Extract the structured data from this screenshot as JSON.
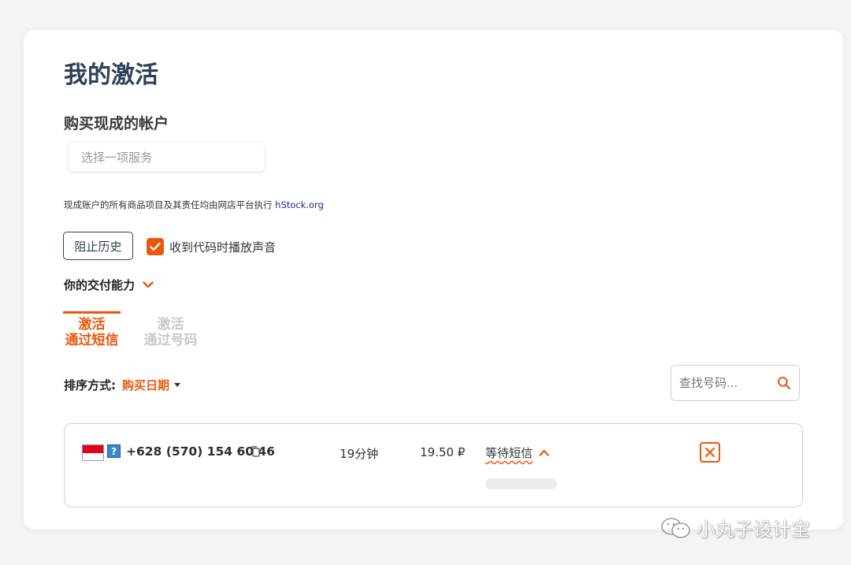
{
  "page_title": "我的激活",
  "section_title": "购买现成的帐户",
  "service_select": {
    "placeholder": "选择一项服务"
  },
  "notice": {
    "text": "现成账户的所有商品项目及其责任均由网店平台执行 ",
    "link": "hStock.org"
  },
  "controls": {
    "block_history_label": "阻止历史",
    "sound_on_code_label": "收到代码时播放声音",
    "sound_on_code_checked": true
  },
  "delivery": {
    "label": "你的交付能力"
  },
  "tabs": [
    {
      "line1": "激活",
      "line2": "通过短信",
      "active": true
    },
    {
      "line1": "激活",
      "line2": "通过号码",
      "active": false
    }
  ],
  "sort": {
    "label": "排序方式:",
    "value": "购买日期"
  },
  "search": {
    "placeholder": "查找号码..."
  },
  "activation": {
    "phone": "+628 (570) 154 60 46",
    "time": "19分钟",
    "price": "19.50 ₽",
    "status": "等待短信"
  },
  "watermark": {
    "text": "小丸子设计宝"
  },
  "colors": {
    "accent": "#e8590c",
    "title": "#2f4058",
    "link": "#1b2a8a"
  }
}
